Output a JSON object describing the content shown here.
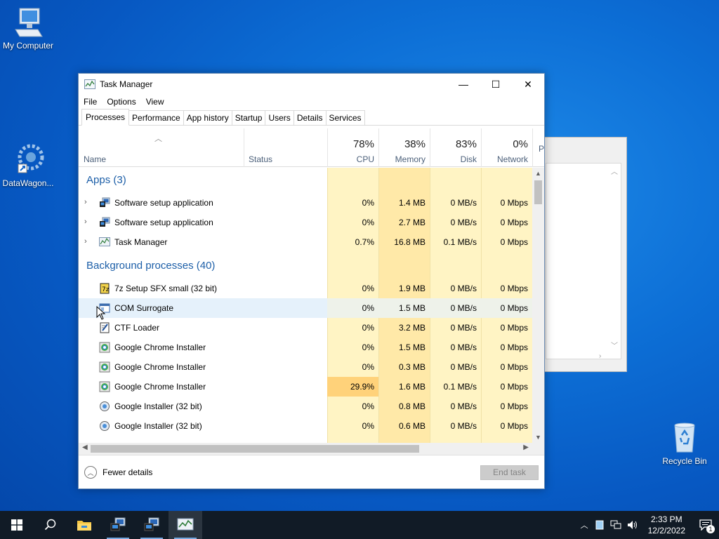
{
  "desktop": {
    "icons": [
      {
        "label": "My Computer"
      },
      {
        "label": "DataWagon..."
      },
      {
        "label": "Recycle Bin"
      }
    ]
  },
  "window": {
    "title": "Task Manager",
    "controls": {
      "minimize": "—",
      "maximize": "☐",
      "close": "✕"
    },
    "menu": [
      "File",
      "Options",
      "View"
    ],
    "tabs": [
      "Processes",
      "Performance",
      "App history",
      "Startup",
      "Users",
      "Details",
      "Services"
    ],
    "active_tab": "Processes"
  },
  "table": {
    "headers": {
      "name": "Name",
      "status": "Status",
      "cpu": {
        "pct": "78%",
        "label": "CPU"
      },
      "memory": {
        "pct": "38%",
        "label": "Memory"
      },
      "disk": {
        "pct": "83%",
        "label": "Disk"
      },
      "network": {
        "pct": "0%",
        "label": "Network"
      },
      "more": "P"
    },
    "groups": {
      "apps": "Apps (3)",
      "background": "Background processes (40)"
    },
    "apps": [
      {
        "name": "Software setup application",
        "cpu": "0%",
        "memory": "1.4 MB",
        "disk": "0 MB/s",
        "network": "0 Mbps"
      },
      {
        "name": "Software setup application",
        "cpu": "0%",
        "memory": "2.7 MB",
        "disk": "0 MB/s",
        "network": "0 Mbps"
      },
      {
        "name": "Task Manager",
        "cpu": "0.7%",
        "memory": "16.8 MB",
        "disk": "0.1 MB/s",
        "network": "0 Mbps"
      }
    ],
    "background": [
      {
        "name": "7z Setup SFX small (32 bit)",
        "cpu": "0%",
        "memory": "1.9 MB",
        "disk": "0 MB/s",
        "network": "0 Mbps"
      },
      {
        "name": "COM Surrogate",
        "cpu": "0%",
        "memory": "1.5 MB",
        "disk": "0 MB/s",
        "network": "0 Mbps"
      },
      {
        "name": "CTF Loader",
        "cpu": "0%",
        "memory": "3.2 MB",
        "disk": "0 MB/s",
        "network": "0 Mbps"
      },
      {
        "name": "Google Chrome Installer",
        "cpu": "0%",
        "memory": "1.5 MB",
        "disk": "0 MB/s",
        "network": "0 Mbps"
      },
      {
        "name": "Google Chrome Installer",
        "cpu": "0%",
        "memory": "0.3 MB",
        "disk": "0 MB/s",
        "network": "0 Mbps"
      },
      {
        "name": "Google Chrome Installer",
        "cpu": "29.9%",
        "memory": "1.6 MB",
        "disk": "0.1 MB/s",
        "network": "0 Mbps"
      },
      {
        "name": "Google Installer (32 bit)",
        "cpu": "0%",
        "memory": "0.8 MB",
        "disk": "0 MB/s",
        "network": "0 Mbps"
      },
      {
        "name": "Google Installer (32 bit)",
        "cpu": "0%",
        "memory": "0.6 MB",
        "disk": "0 MB/s",
        "network": "0 Mbps"
      }
    ]
  },
  "footer": {
    "fewer_details": "Fewer details",
    "end_task": "End task"
  },
  "taskbar": {
    "clock_time": "2:33 PM",
    "clock_date": "12/2/2022",
    "notification_count": "1"
  },
  "colors": {
    "heat_light": "#fff4c4",
    "heat_medium": "#ffe9a8",
    "heat_high": "#ffd27a",
    "accent": "#1d5fa8"
  }
}
